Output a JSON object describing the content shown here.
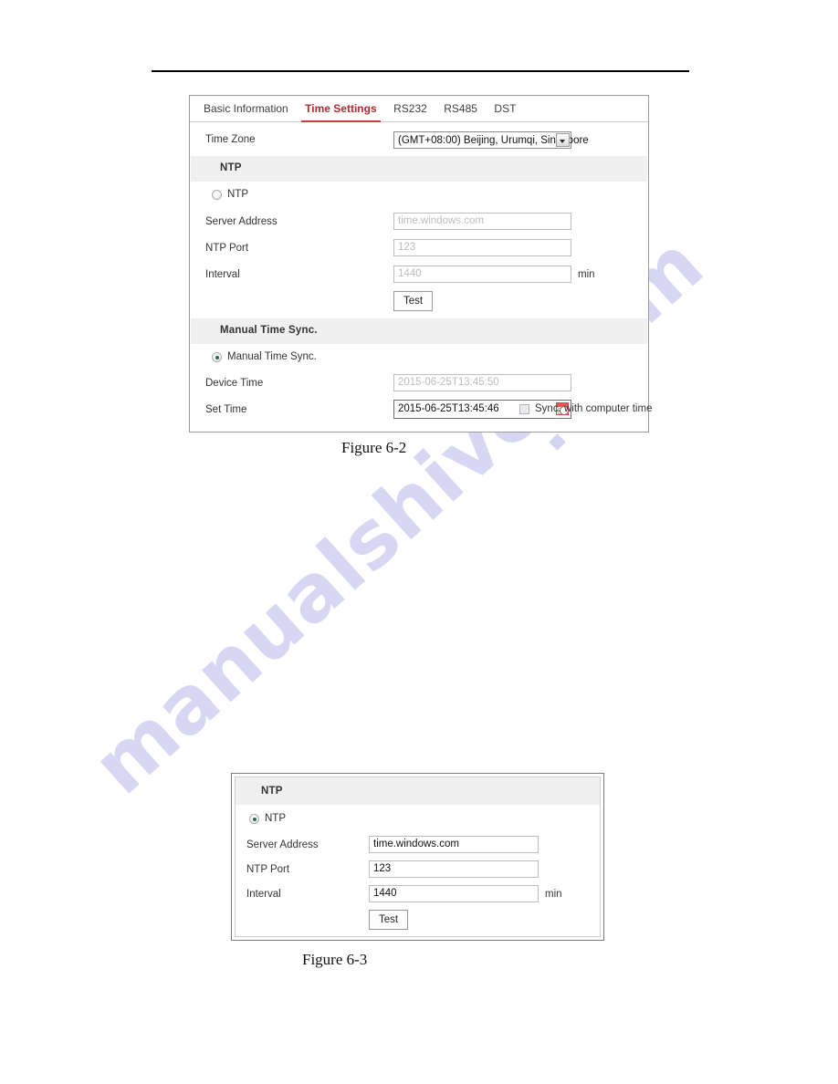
{
  "page": {
    "watermark": "manualshive.com"
  },
  "figure_6_2": {
    "caption": "Figure 6-2",
    "tabs": [
      {
        "label": "Basic Information",
        "active": false
      },
      {
        "label": "Time Settings",
        "active": true
      },
      {
        "label": "RS232",
        "active": false
      },
      {
        "label": "RS485",
        "active": false
      },
      {
        "label": "DST",
        "active": false
      }
    ],
    "time_zone": {
      "label": "Time Zone",
      "value": "(GMT+08:00) Beijing, Urumqi, Singapore"
    },
    "ntp_section": {
      "title": "NTP",
      "radio_label": "NTP",
      "radio_selected": false,
      "server_address": {
        "label": "Server Address",
        "placeholder": "time.windows.com",
        "value": ""
      },
      "ntp_port": {
        "label": "NTP Port",
        "placeholder": "123",
        "value": ""
      },
      "interval": {
        "label": "Interval",
        "placeholder": "1440",
        "value": "",
        "unit": "min"
      },
      "test_button": "Test"
    },
    "manual_section": {
      "title": "Manual Time Sync.",
      "radio_label": "Manual Time Sync.",
      "radio_selected": true,
      "device_time": {
        "label": "Device Time",
        "value": "2015-06-25T13:45:50"
      },
      "set_time": {
        "label": "Set Time",
        "value": "2015-06-25T13:45:46"
      },
      "sync_checkbox": {
        "label": "Sync. with computer time",
        "checked": false
      },
      "calendar_icon": "calendar-icon"
    }
  },
  "figure_6_3": {
    "caption": "Figure 6-3",
    "ntp_section": {
      "title": "NTP",
      "radio_label": "NTP",
      "radio_selected": true,
      "server_address": {
        "label": "Server Address",
        "value": "time.windows.com"
      },
      "ntp_port": {
        "label": "NTP Port",
        "value": "123"
      },
      "interval": {
        "label": "Interval",
        "value": "1440",
        "unit": "min"
      },
      "test_button": "Test"
    }
  }
}
